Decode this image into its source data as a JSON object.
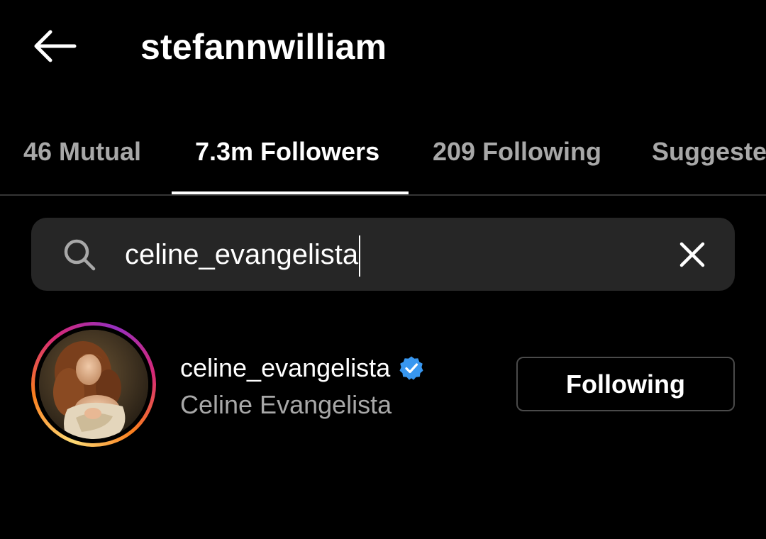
{
  "header": {
    "title": "stefannwilliam",
    "back_icon": "arrow-left-icon"
  },
  "tabs": [
    {
      "label": "46 Mutual",
      "active": false
    },
    {
      "label": "7.3m Followers",
      "active": true
    },
    {
      "label": "209 Following",
      "active": false
    },
    {
      "label": "Suggeste",
      "active": false
    }
  ],
  "search": {
    "icon": "search-icon",
    "value": "celine_evangelista",
    "clear_icon": "close-icon"
  },
  "results": [
    {
      "username": "celine_evangelista",
      "full_name": "Celine Evangelista",
      "verified": true,
      "button_label": "Following"
    }
  ],
  "colors": {
    "background": "#000000",
    "primary_text": "#ffffff",
    "secondary_text": "#a8a8a8",
    "search_background": "#262626",
    "verified_badge": "#3897f0",
    "button_border": "#4a4a4a"
  }
}
